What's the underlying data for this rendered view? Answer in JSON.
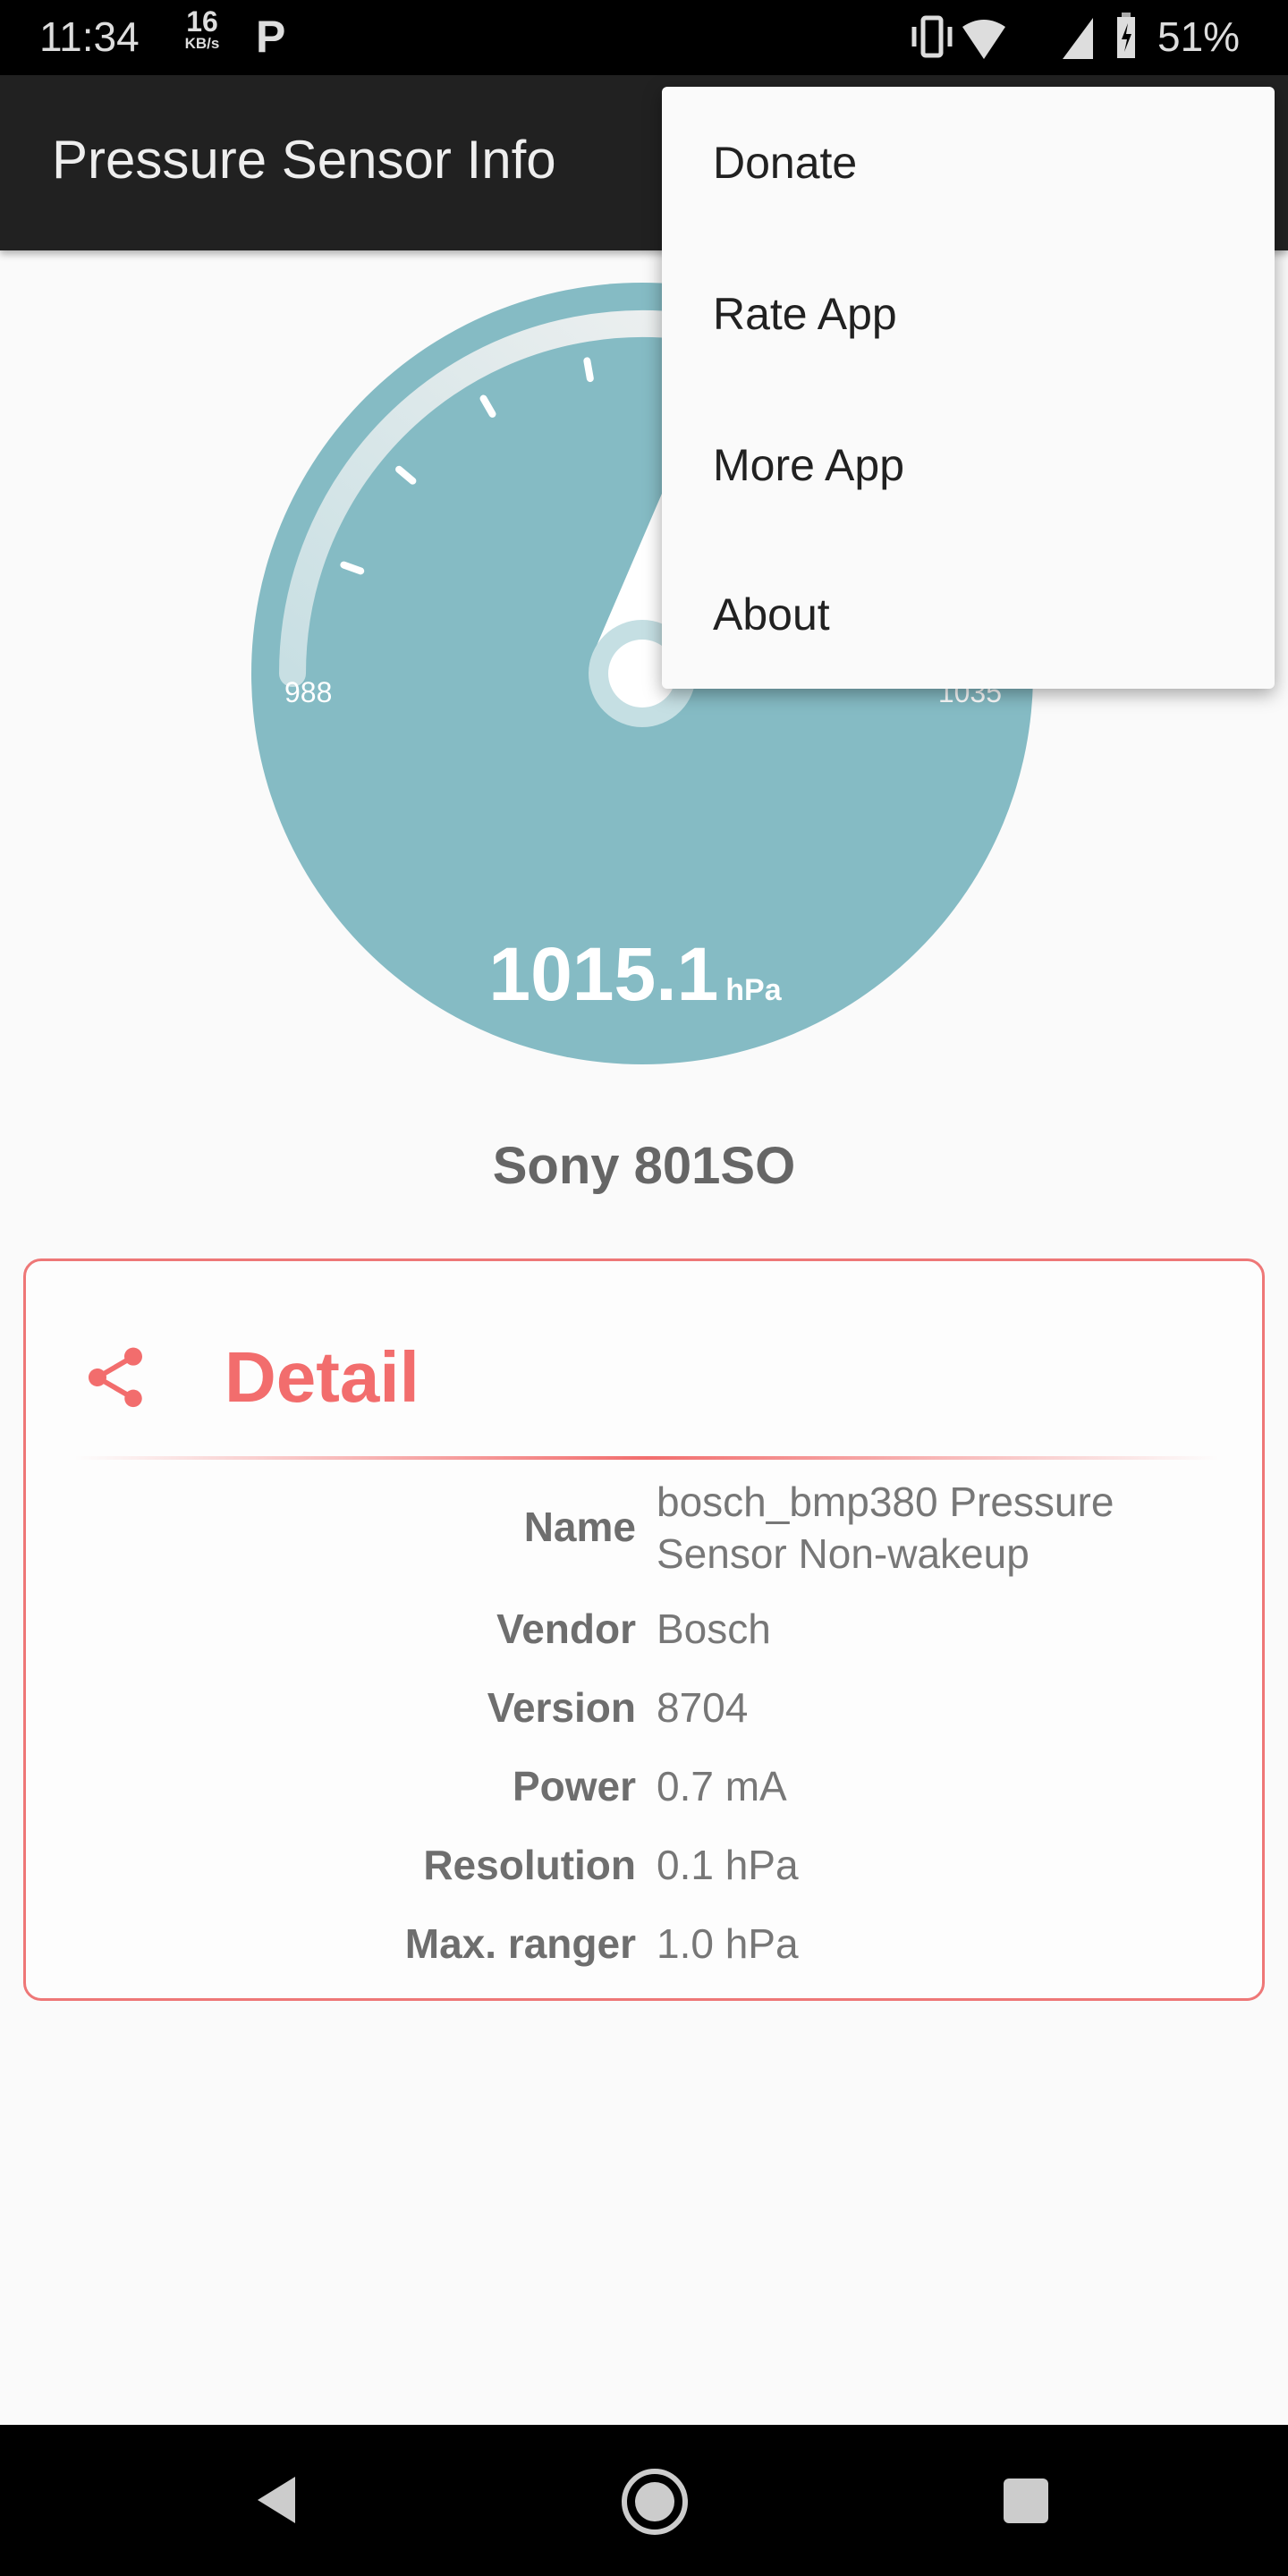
{
  "status_bar": {
    "time": "11:34",
    "net_speed_value": "16",
    "net_speed_unit": "KB/s",
    "notification_icon": "P",
    "battery": "51%",
    "icons": [
      "vibrate-icon",
      "wifi-icon",
      "signal-icon",
      "battery-charging-icon"
    ]
  },
  "app_bar": {
    "title": "Pressure Sensor Info"
  },
  "overflow_menu": {
    "items": [
      {
        "label": "Donate"
      },
      {
        "label": "Rate App"
      },
      {
        "label": "More App"
      },
      {
        "label": "About"
      }
    ]
  },
  "gauge": {
    "min_label": "988",
    "max_label": "1035",
    "min": 988,
    "max": 1035,
    "value": 1015.1,
    "value_text": "1015.1",
    "unit": "hPa",
    "color": "#85bbc4"
  },
  "device_name": "Sony 801SO",
  "detail": {
    "title": "Detail",
    "accent": "#f26d6d",
    "rows": [
      {
        "label": "Name",
        "value": "bosch_bmp380 Pressure Sensor Non-wakeup"
      },
      {
        "label": "Vendor",
        "value": "Bosch"
      },
      {
        "label": "Version",
        "value": "8704"
      },
      {
        "label": "Power",
        "value": "0.7 mA"
      },
      {
        "label": "Resolution",
        "value": "0.1 hPa"
      },
      {
        "label": "Max. ranger",
        "value": "1.0 hPa"
      }
    ]
  },
  "nav_bar": {
    "buttons": [
      "back-icon",
      "home-icon",
      "recents-icon"
    ]
  }
}
